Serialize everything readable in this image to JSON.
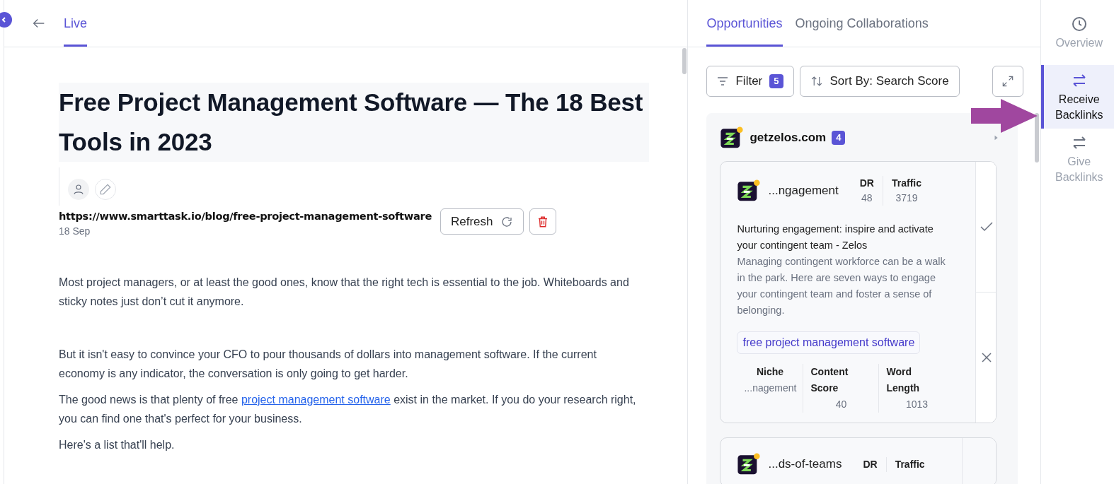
{
  "header": {
    "tabs": [
      {
        "label": "Live",
        "selected": true
      }
    ]
  },
  "article": {
    "title": "Free Project Management Software — The 18 Best Tools in 2023",
    "url": "https://www.smarttask.io/blog/free-project-management-software",
    "date": "18 Sep",
    "refresh_label": "Refresh",
    "paragraphs": [
      {
        "parts": [
          {
            "text": "Most project managers, or at least the good ones, know that the right tech is essential to the job. Whiteboards and sticky notes just don’t cut it anymore.",
            "kind": "text"
          }
        ]
      },
      {
        "parts": [
          {
            "text": "But it isn't easy to convince your CFO to pour thousands of dollars into management software. If the current economy is any indicator, the conversation is only going to get harder.",
            "kind": "text"
          }
        ]
      },
      {
        "parts": [
          {
            "text": "The good news is that plenty of free ",
            "kind": "text"
          },
          {
            "text": "project management software",
            "kind": "link"
          },
          {
            "text": " exist in the market. If you do your research right, you can find one that's perfect for your business.",
            "kind": "text"
          }
        ]
      },
      {
        "parts": [
          {
            "text": "Here's a list that'll help.",
            "kind": "text"
          }
        ]
      }
    ]
  },
  "panel": {
    "tabs": [
      {
        "label": "Opportunities",
        "selected": true
      },
      {
        "label": "Ongoing Collaborations",
        "selected": false
      }
    ],
    "filter": {
      "label": "Filter",
      "count": "5"
    },
    "sort": {
      "label": "Sort By: Search Score"
    },
    "groups": [
      {
        "domain": "getzelos.com",
        "count": "4",
        "cards": [
          {
            "title": "...ngagement",
            "stats": [
              {
                "label": "DR",
                "value": "48"
              },
              {
                "label": "Traffic",
                "value": "3719"
              }
            ],
            "headline": "Nurturing engagement: inspire and activate your contingent team - Zelos",
            "description": "Managing contingent workforce can be a walk in the park. Here are seven ways to engage your contingent team and foster a sense of belonging.",
            "keyword": "free project management software",
            "metrics": [
              {
                "label": "Niche",
                "value": "...nagement"
              },
              {
                "label": "Content Score",
                "value": "40"
              },
              {
                "label": "Word Length",
                "value": "1013"
              }
            ]
          },
          {
            "title": "...ds-of-teams",
            "stats": [
              {
                "label": "DR"
              },
              {
                "label": "Traffic"
              }
            ]
          }
        ]
      }
    ]
  },
  "nav": [
    {
      "label": "Overview",
      "kind": "clock",
      "selected": false
    },
    {
      "label": "Receive Backlinks",
      "kind": "receive",
      "selected": true
    },
    {
      "label": "Give Backlinks",
      "kind": "give",
      "selected": false
    }
  ]
}
